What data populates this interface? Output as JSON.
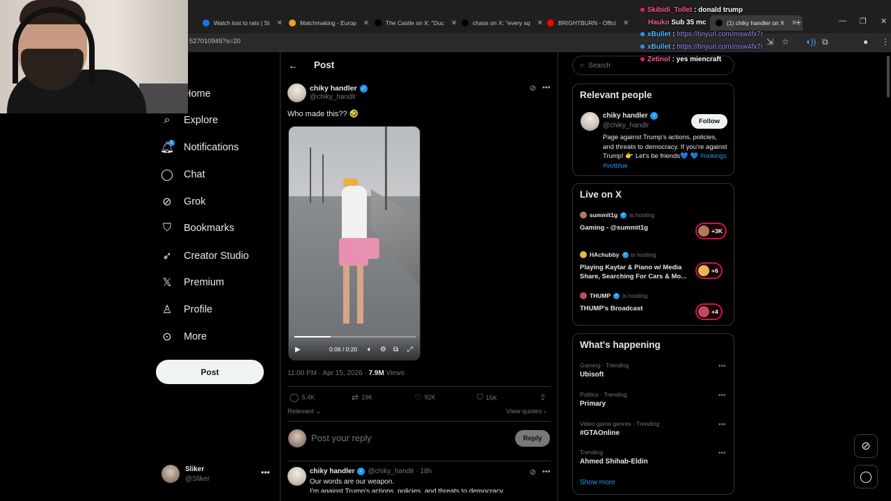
{
  "browser": {
    "tabs": [
      {
        "label": "Watch lost to rats | St",
        "color": "#1a73e8"
      },
      {
        "label": "Matchmaking - Europ",
        "color": "#f29c1f"
      },
      {
        "label": "The Castle on X: \"Duc",
        "color": "#000000"
      },
      {
        "label": "chaos on X: \"every sq",
        "color": "#000000"
      },
      {
        "label": "BRIGHTBURN - Offici",
        "color": "#ff0000"
      },
      {
        "label": "(1) chiky handler on X",
        "color": "#000000"
      }
    ],
    "url": "527010945?s=20"
  },
  "chat_overlay": [
    {
      "user": "Skibidi_Tollet",
      "text": "donald trump",
      "color": "#e91e63",
      "is_link": false
    },
    {
      "user": "xBullet",
      "text": "https://tinyurl.com/msw4fx7r",
      "color": "#2196f3",
      "is_link": true
    },
    {
      "user": "xBullet",
      "text": "https://tinyurl.com/msw4fx7r",
      "color": "#2196f3",
      "is_link": true
    },
    {
      "user": "Zetinol",
      "text": "yes miencraft",
      "color": "#e91e63",
      "is_link": false
    }
  ],
  "chat_header": {
    "text": "Sub 35 mc",
    "user": "Hauko"
  },
  "nav": {
    "items": [
      {
        "label": "Home",
        "icon": "home-icon"
      },
      {
        "label": "Explore",
        "icon": "search-icon"
      },
      {
        "label": "Notifications",
        "icon": "bell-icon"
      },
      {
        "label": "Chat",
        "icon": "chat-icon"
      },
      {
        "label": "Grok",
        "icon": "grok-icon"
      },
      {
        "label": "Bookmarks",
        "icon": "bookmark-icon"
      },
      {
        "label": "Creator Studio",
        "icon": "rocket-icon"
      },
      {
        "label": "Premium",
        "icon": "x-logo-icon"
      },
      {
        "label": "Profile",
        "icon": "person-icon"
      },
      {
        "label": "More",
        "icon": "more-circle-icon"
      }
    ],
    "notification_badge": "1",
    "post_button": "Post",
    "account": {
      "name": "Sliker",
      "handle": "@Sliker"
    }
  },
  "post": {
    "header": "Post",
    "author_name": "chiky handler",
    "author_handle": "@chiky_handlr",
    "text": "Who made this?? 🤣",
    "video": {
      "time": "0:06 / 0:20",
      "progress": 0.3
    },
    "meta_time": "11:00 PM · Apr 15, 2026 · ",
    "meta_views": "7.9M",
    "meta_views_label": " Views",
    "actions": {
      "replies": "5.4K",
      "reposts": "19K",
      "likes": "92K",
      "bookmarks": "15K"
    },
    "sort": "Relevant",
    "view_quotes": "View quotes",
    "reply_placeholder": "Post your reply",
    "reply_button": "Reply"
  },
  "reply": {
    "author_name": "chiky handler",
    "author_handle": "@chiky_handlr · 18h",
    "line1": "Our words are our weapon.",
    "line2": "I'm against Trump's actions, policies, and threats to democracy."
  },
  "search": {
    "placeholder": "Search"
  },
  "relevant_people": {
    "title": "Relevant people",
    "name": "chiky handler",
    "handle": "@chiky_handlr",
    "follow": "Follow",
    "bio": "Page against Trump's actions, policies, and threats to democracy. If you're against Trump! 👉 Let's be friends💙",
    "bio_tags": "💙 #nokings #votblue"
  },
  "live": {
    "title": "Live on X",
    "hosting_label": "is hosting",
    "items": [
      {
        "host": "summit1g",
        "title": "Gaming - @summit1g",
        "count": "+3K",
        "color": "#b07a5a"
      },
      {
        "host": "HAchubby",
        "title": "Playing Kaytar & Piano w/ Media Share, Searching For Cars & Mo...",
        "count": "+6",
        "color": "#e8b84a"
      },
      {
        "host": "THUMP",
        "title": "THUMP's Broadcast",
        "count": "+4",
        "color": "#c04a5a"
      }
    ]
  },
  "trending": {
    "title": "What's happening",
    "items": [
      {
        "category": "Gaming · Trending",
        "name": "Ubisoft"
      },
      {
        "category": "Politics · Trending",
        "name": "Primary"
      },
      {
        "category": "Video game genres · Trending",
        "name": "#GTAOnline"
      },
      {
        "category": "Trending",
        "name": "Ahmed Shihab-Eldin"
      }
    ],
    "show_more": "Show more"
  }
}
